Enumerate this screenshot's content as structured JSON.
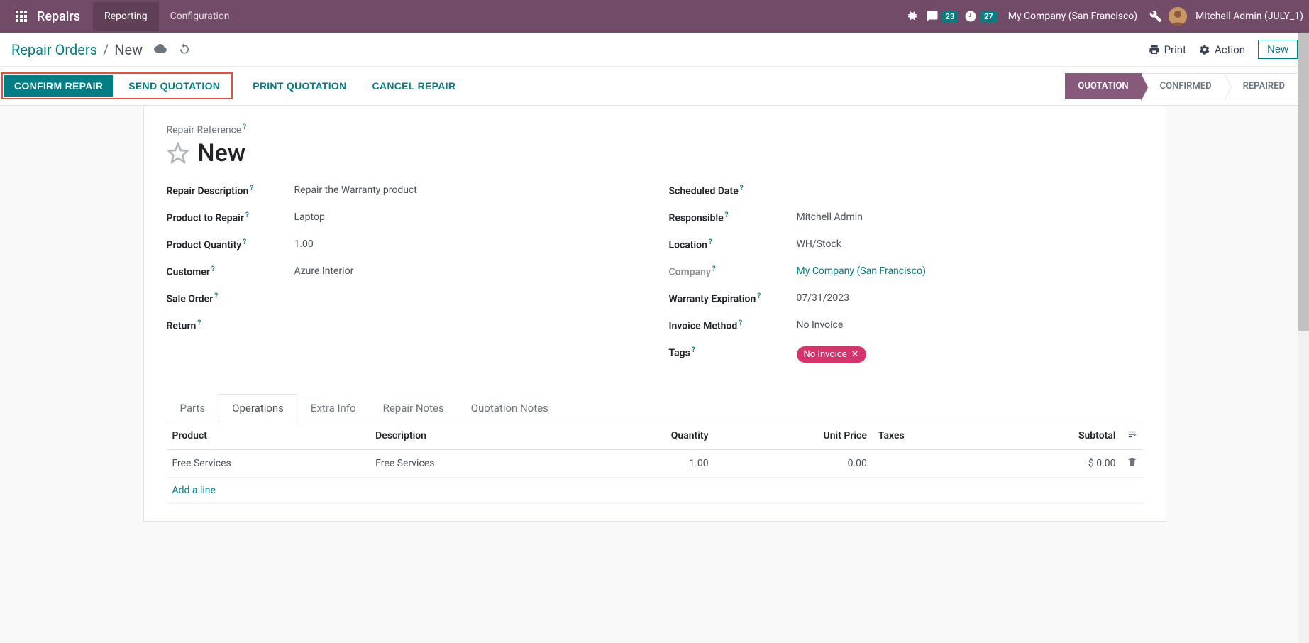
{
  "topbar": {
    "app_name": "Repairs",
    "nav": [
      "Reporting",
      "Configuration"
    ],
    "messages_count": "23",
    "activities_count": "27",
    "company": "My Company (San Francisco)",
    "user": "Mitchell Admin (JULY_1)"
  },
  "control_panel": {
    "breadcrumb_root": "Repair Orders",
    "breadcrumb_current": "New",
    "print_label": "Print",
    "action_label": "Action",
    "new_label": "New"
  },
  "status_buttons": {
    "confirm": "CONFIRM REPAIR",
    "send_quotation": "SEND QUOTATION",
    "print_quotation": "PRINT QUOTATION",
    "cancel": "CANCEL REPAIR"
  },
  "status_steps": [
    "QUOTATION",
    "CONFIRMED",
    "REPAIRED"
  ],
  "form": {
    "title_label": "Repair Reference",
    "title_value": "New",
    "left": {
      "repair_description_label": "Repair Description",
      "repair_description": "Repair the Warranty  product",
      "product_label": "Product to Repair",
      "product": "Laptop",
      "qty_label": "Product Quantity",
      "qty": "1.00",
      "customer_label": "Customer",
      "customer": "Azure Interior",
      "sale_order_label": "Sale Order",
      "sale_order": "",
      "return_label": "Return",
      "return": ""
    },
    "right": {
      "scheduled_label": "Scheduled Date",
      "scheduled": "",
      "responsible_label": "Responsible",
      "responsible": "Mitchell Admin",
      "location_label": "Location",
      "location": "WH/Stock",
      "company_label": "Company",
      "company": "My Company (San Francisco)",
      "warranty_label": "Warranty Expiration",
      "warranty": "07/31/2023",
      "invoice_method_label": "Invoice Method",
      "invoice_method": "No Invoice",
      "tags_label": "Tags",
      "tag_value": "No Invoice"
    }
  },
  "tabs": [
    "Parts",
    "Operations",
    "Extra Info",
    "Repair Notes",
    "Quotation Notes"
  ],
  "table": {
    "headers": {
      "product": "Product",
      "description": "Description",
      "quantity": "Quantity",
      "unit_price": "Unit Price",
      "taxes": "Taxes",
      "subtotal": "Subtotal"
    },
    "rows": [
      {
        "product": "Free Services",
        "description": "Free Services",
        "quantity": "1.00",
        "unit_price": "0.00",
        "taxes": "",
        "subtotal": "$ 0.00"
      }
    ],
    "add_line": "Add a line"
  }
}
